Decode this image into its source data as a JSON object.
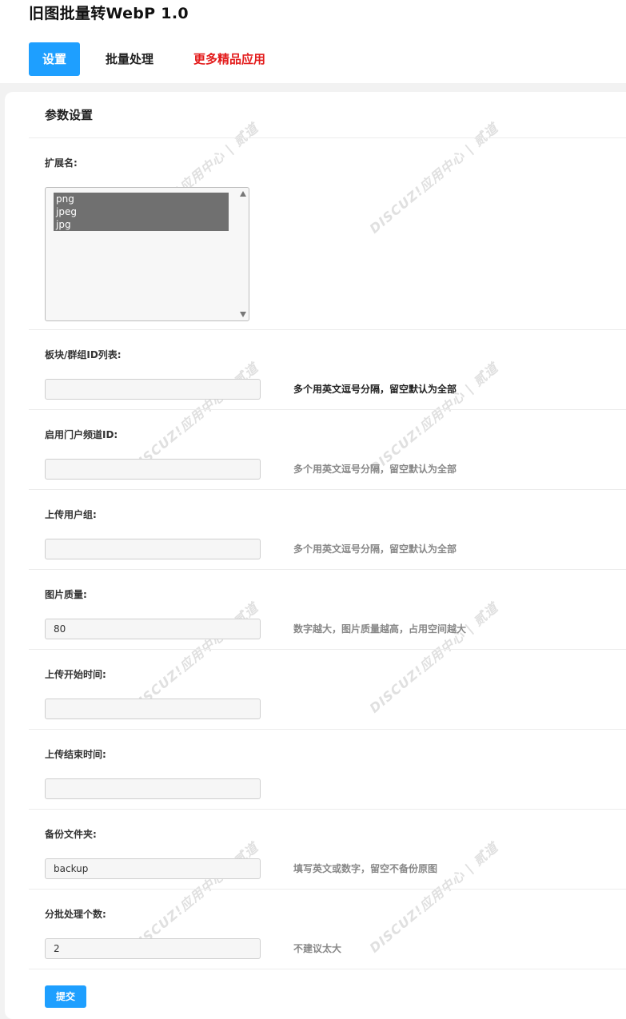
{
  "app": {
    "title": "旧图批量转WebP 1.0"
  },
  "tabs": [
    {
      "label": "设置"
    },
    {
      "label": "批量处理"
    },
    {
      "label": "更多精品应用"
    }
  ],
  "section": {
    "title": "参数设置"
  },
  "fields": {
    "extension": {
      "label": "扩展名:",
      "options": [
        "png",
        "jpeg",
        "jpg"
      ]
    },
    "forum_ids": {
      "label": "板块/群组ID列表:",
      "value": "",
      "hint": "多个用英文逗号分隔，留空默认为全部"
    },
    "portal_ids": {
      "label": "启用门户频道ID:",
      "value": "",
      "hint": "多个用英文逗号分隔，留空默认为全部"
    },
    "upload_groups": {
      "label": "上传用户组:",
      "value": "",
      "hint": "多个用英文逗号分隔，留空默认为全部"
    },
    "quality": {
      "label": "图片质量:",
      "value": "80",
      "hint": "数字越大，图片质量越高，占用空间越大"
    },
    "start_time": {
      "label": "上传开始时间:",
      "value": ""
    },
    "end_time": {
      "label": "上传结束时间:",
      "value": ""
    },
    "backup_folder": {
      "label": "备份文件夹:",
      "value": "backup",
      "hint": "填写英文或数字，留空不备份原图"
    },
    "batch_count": {
      "label": "分批处理个数:",
      "value": "2",
      "hint": "不建议太大"
    }
  },
  "submit": {
    "label": "提交"
  },
  "watermark": {
    "text": "DISCUZ!应用中心 addon.dismall.com 贰道"
  },
  "colors": {
    "accent": "#1e9fff",
    "more_link": "#e31b1b"
  }
}
